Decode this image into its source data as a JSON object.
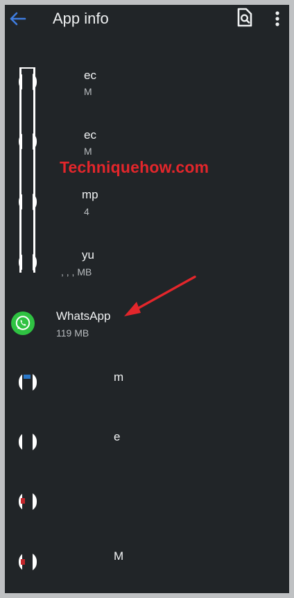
{
  "header": {
    "title": "App info",
    "back_icon": "arrow-left-icon",
    "search_icon": "search-document-icon",
    "more_icon": "more-vert-icon"
  },
  "apps": [
    {
      "name_fragment": "ec",
      "size_fragment": "M"
    },
    {
      "name_fragment": "ec",
      "size_fragment": "M"
    },
    {
      "name_fragment": "mp",
      "size_fragment": "4"
    },
    {
      "name_fragment": "yu",
      "size_fragment": ", , , MB"
    },
    {
      "name": "WhatsApp",
      "size": "119 MB",
      "icon": "whatsapp-icon"
    },
    {
      "name_fragment": "m",
      "size_fragment": ""
    },
    {
      "name_fragment": "e",
      "size_fragment": ""
    },
    {
      "name_fragment": "",
      "size_fragment": ""
    },
    {
      "name_fragment": "M",
      "size_fragment": ""
    }
  ],
  "watermark": "Techniquehow.com",
  "colors": {
    "background": "#212528",
    "accent_back": "#3f7de0",
    "whatsapp_green": "#2fc242",
    "annotation_red": "#e3262b"
  }
}
